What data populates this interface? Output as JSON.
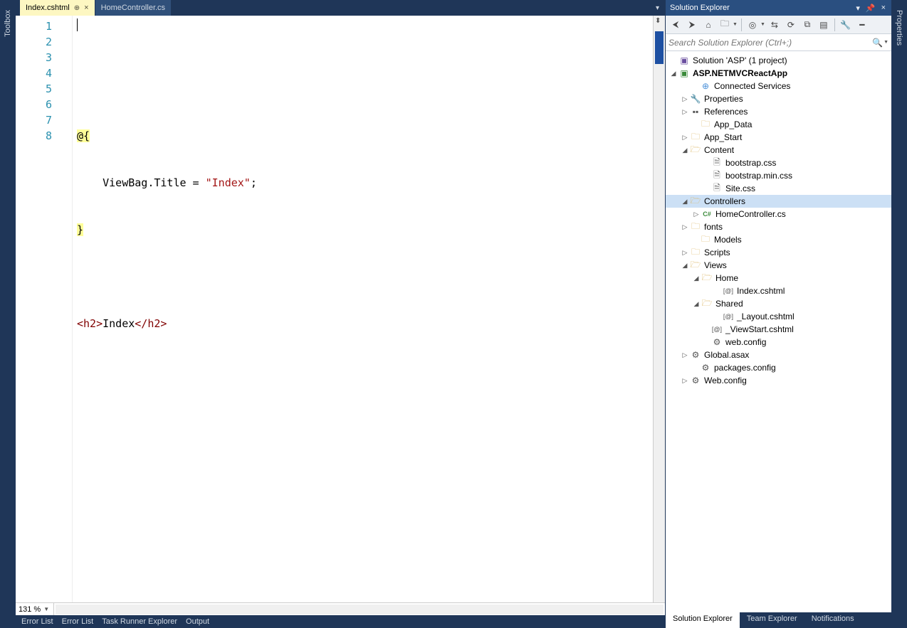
{
  "leftStrip": {
    "toolbox": "Toolbox"
  },
  "rightStrip": {
    "properties": "Properties"
  },
  "tabs": {
    "active": "Index.cshtml",
    "inactive": "HomeController.cs"
  },
  "editor": {
    "lines": [
      "1",
      "2",
      "3",
      "4",
      "5",
      "6",
      "7",
      "8"
    ],
    "code": {
      "l2a": "@{",
      "l3a": "    ViewBag.Title = ",
      "l3b": "\"Index\"",
      "l3c": ";",
      "l4a": "}",
      "l6a": "<",
      "l6b": "h2",
      "l6c": ">",
      "l6d": "Index",
      "l6e": "</",
      "l6f": "h2",
      "l6g": ">"
    },
    "zoom": "131 %"
  },
  "statusBar": {
    "items": [
      "Error List",
      "Error List",
      "Task Runner Explorer",
      "Output"
    ]
  },
  "solutionExplorer": {
    "title": "Solution Explorer",
    "searchPlaceholder": "Search Solution Explorer (Ctrl+;)",
    "tabs": {
      "solution": "Solution Explorer",
      "team": "Team Explorer",
      "notifications": "Notifications"
    },
    "tree": {
      "solution": "Solution 'ASP' (1 project)",
      "project": "ASP.NETMVCReactApp",
      "connected": "Connected Services",
      "properties": "Properties",
      "references": "References",
      "appData": "App_Data",
      "appStart": "App_Start",
      "content": "Content",
      "bootstrapCss": "bootstrap.css",
      "bootstrapMinCss": "bootstrap.min.css",
      "siteCss": "Site.css",
      "controllers": "Controllers",
      "homeController": "HomeController.cs",
      "fonts": "fonts",
      "models": "Models",
      "scripts": "Scripts",
      "views": "Views",
      "home": "Home",
      "indexCshtml": "Index.cshtml",
      "shared": "Shared",
      "layoutCshtml": "_Layout.cshtml",
      "viewStart": "_ViewStart.cshtml",
      "webConfigViews": "web.config",
      "globalAsax": "Global.asax",
      "packagesConfig": "packages.config",
      "webConfig": "Web.config"
    }
  }
}
